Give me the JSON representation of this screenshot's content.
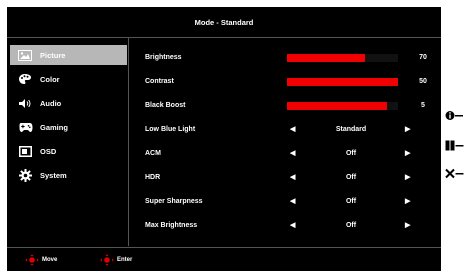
{
  "header": {
    "title": "Mode - Standard"
  },
  "sidebar": {
    "items": [
      {
        "label": "Picture",
        "icon": "picture-icon",
        "active": true
      },
      {
        "label": "Color",
        "icon": "palette-icon",
        "active": false
      },
      {
        "label": "Audio",
        "icon": "speaker-icon",
        "active": false
      },
      {
        "label": "Gaming",
        "icon": "gamepad-icon",
        "active": false
      },
      {
        "label": "OSD",
        "icon": "screen-icon",
        "active": false
      },
      {
        "label": "System",
        "icon": "gear-icon",
        "active": false
      }
    ]
  },
  "settings": {
    "brightness": {
      "label": "Brightness",
      "value": "70",
      "level": 0.7
    },
    "contrast": {
      "label": "Contrast",
      "value": "50",
      "level": 1.0
    },
    "black_boost": {
      "label": "Black Boost",
      "value": "5",
      "level": 0.9
    },
    "low_blue_light": {
      "label": "Low Blue Light",
      "value": "Standard"
    },
    "acm": {
      "label": "ACM",
      "value": "Off"
    },
    "hdr": {
      "label": "HDR",
      "value": "Off"
    },
    "super_sharpness": {
      "label": "Super Sharpness",
      "value": "Off"
    },
    "max_brightness": {
      "label": "Max Brightness",
      "value": "Off"
    }
  },
  "footer": {
    "move_label": "Move",
    "enter_label": "Enter"
  },
  "colors": {
    "accent": "#f00000",
    "highlight": "#b7b7b7",
    "background": "#000000"
  }
}
